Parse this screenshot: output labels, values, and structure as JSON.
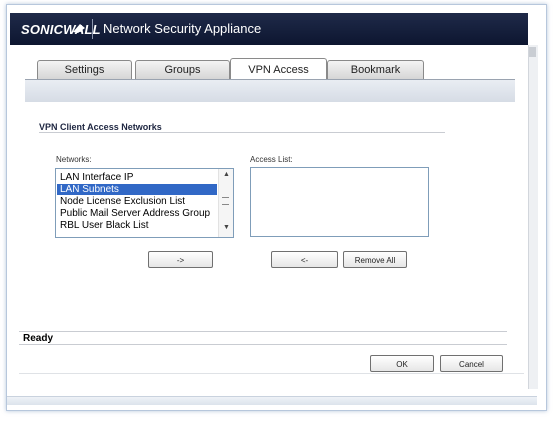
{
  "header": {
    "logo": "SONICWALL",
    "title": "Network Security Appliance"
  },
  "tabs": [
    {
      "label": "Settings",
      "active": false
    },
    {
      "label": "Groups",
      "active": false
    },
    {
      "label": "VPN Access",
      "active": true
    },
    {
      "label": "Bookmark",
      "active": false
    }
  ],
  "section": {
    "title": "VPN Client Access Networks"
  },
  "networks": {
    "label": "Networks:",
    "items": [
      "LAN Interface IP",
      "LAN Subnets",
      "Node License Exclusion List",
      "Public Mail Server Address Group",
      "RBL User Black List"
    ],
    "selected": "LAN Subnets"
  },
  "access_list": {
    "label": "Access List:"
  },
  "buttons": {
    "add": "->",
    "remove": "<-",
    "remove_all": "Remove All",
    "ok": "OK",
    "cancel": "Cancel"
  },
  "status": {
    "text": "Ready"
  },
  "colors": {
    "header_bg": "#151e3a",
    "selection": "#3168c6"
  }
}
